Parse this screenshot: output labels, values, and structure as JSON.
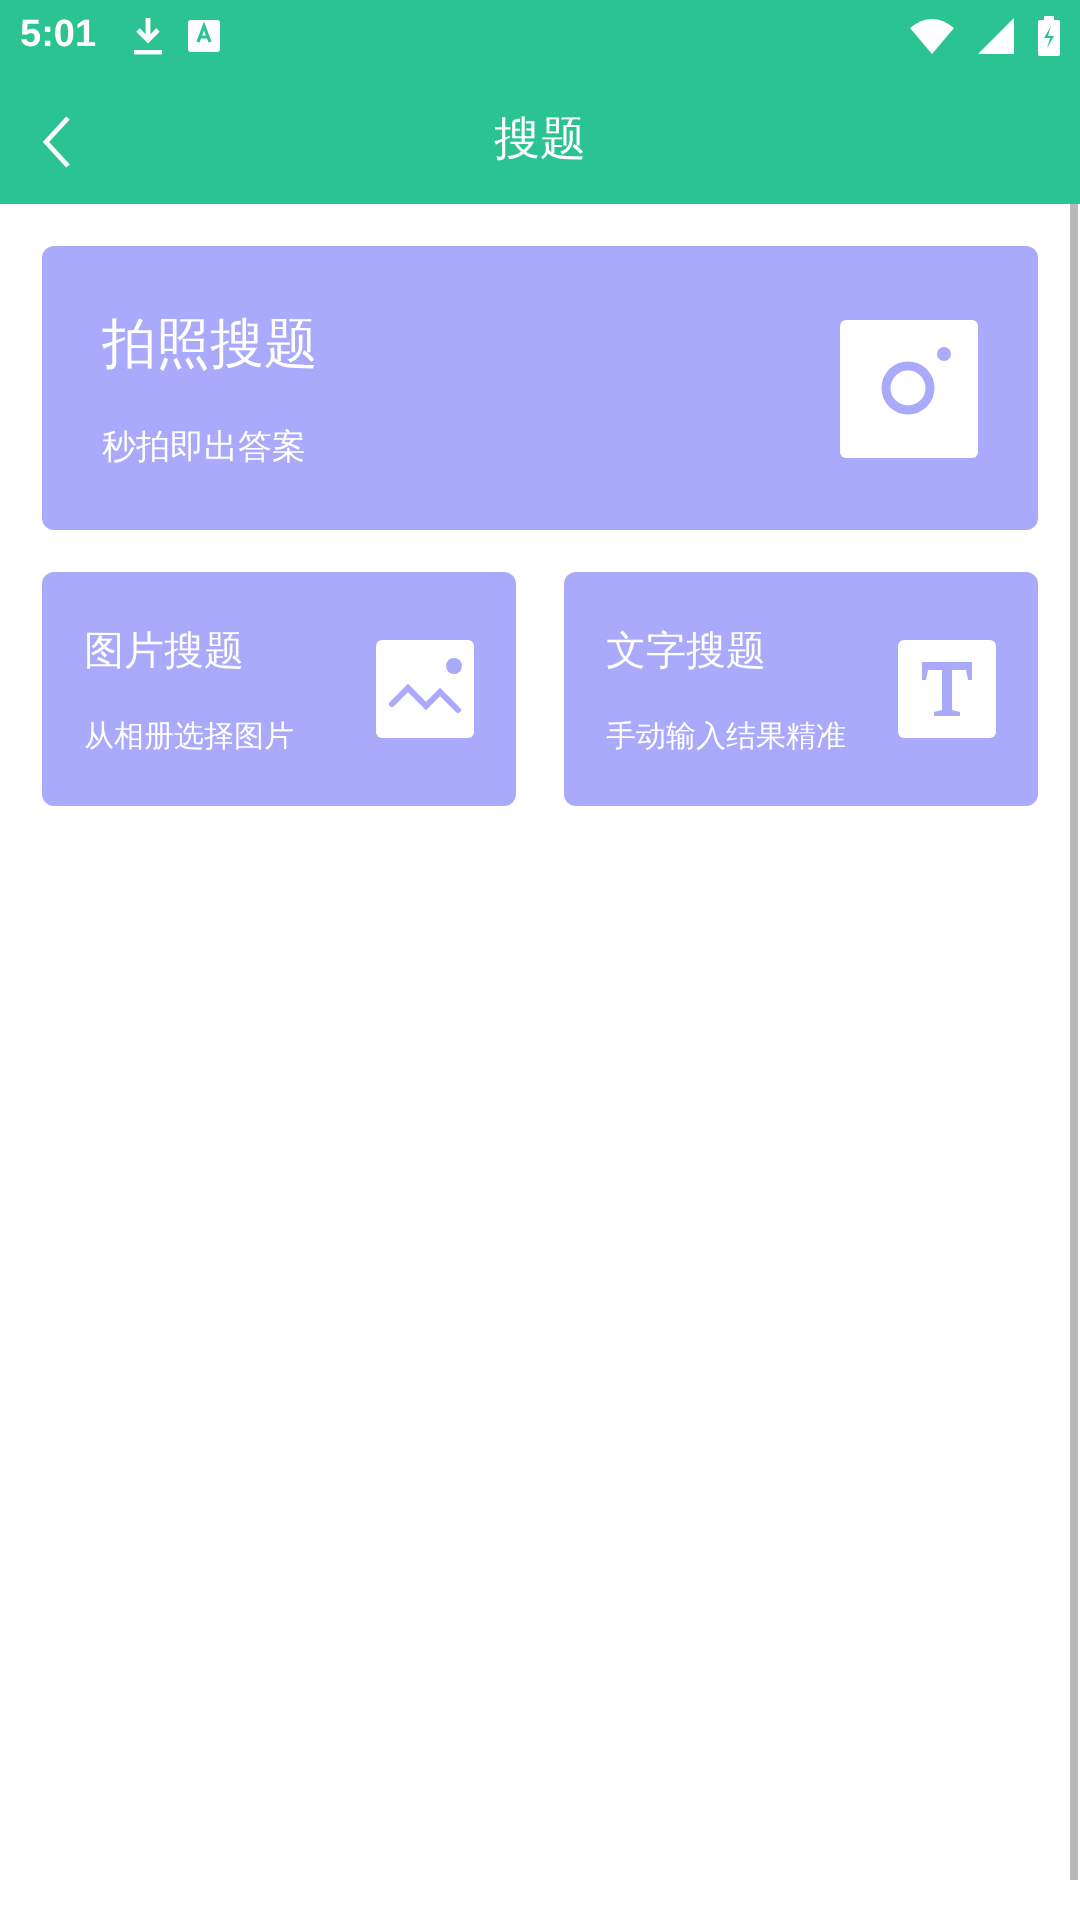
{
  "status_bar": {
    "time": "5:01"
  },
  "app_bar": {
    "title": "搜题"
  },
  "main_card": {
    "title": "拍照搜题",
    "subtitle": "秒拍即出答案"
  },
  "cards": [
    {
      "kind": "image",
      "title": "图片搜题",
      "subtitle": "从相册选择图片"
    },
    {
      "kind": "text",
      "title": "文字搜题",
      "subtitle": "手动输入结果精准"
    }
  ]
}
